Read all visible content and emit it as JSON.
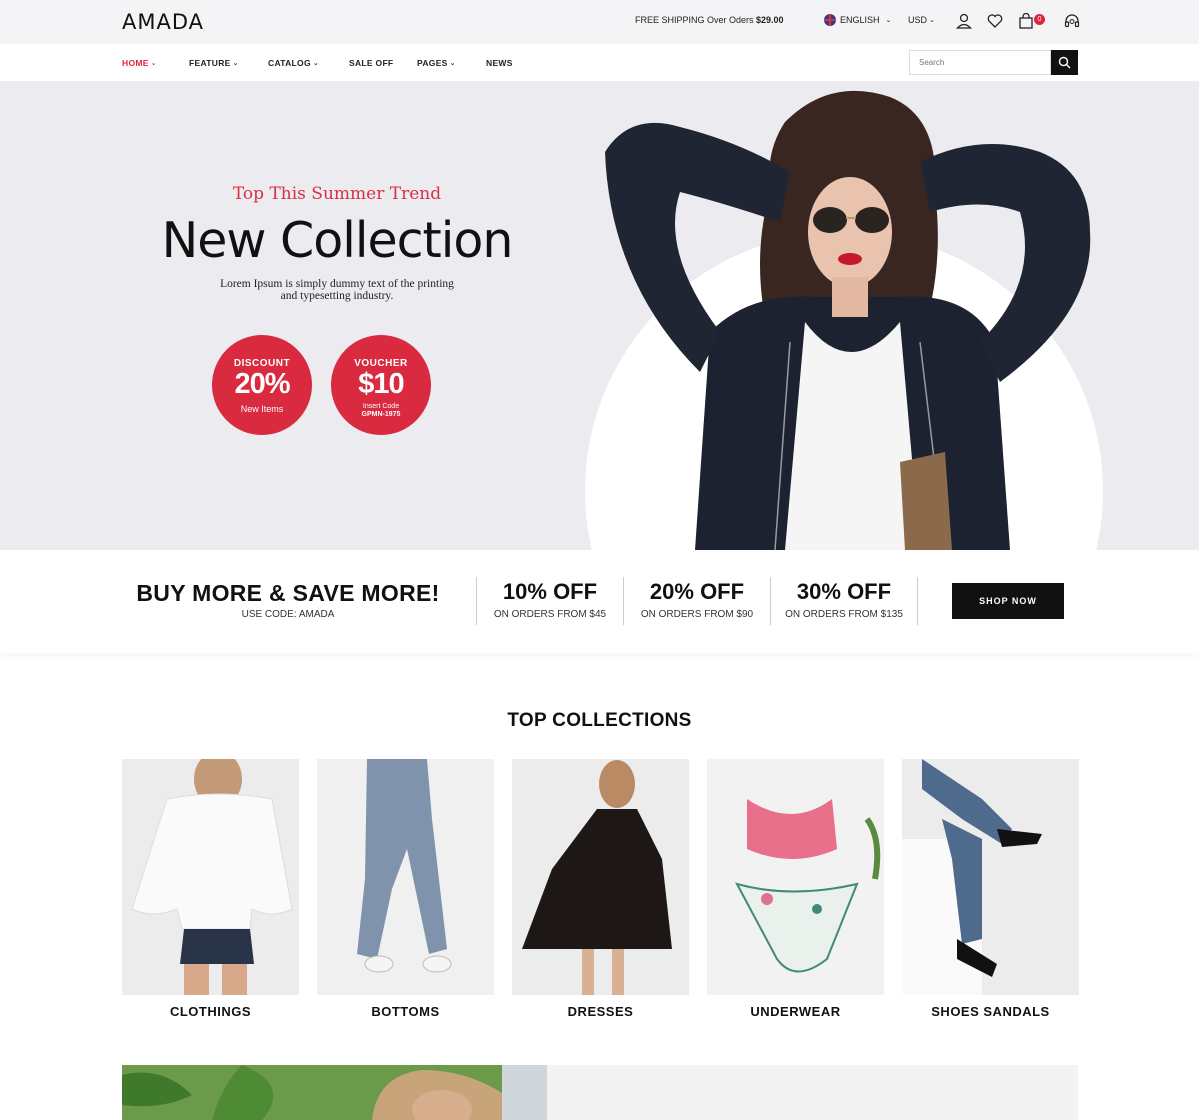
{
  "header": {
    "logo": "AMADA",
    "shipping_text": "FREE SHIPPING Over Oders ",
    "shipping_amount": "$29.00",
    "language": "ENGLISH",
    "currency": "USD",
    "cart_count": "0"
  },
  "nav": {
    "items": [
      "HOME",
      "FEATURE",
      "CATALOG",
      "SALE OFF",
      "PAGES",
      "NEWS"
    ],
    "search_placeholder": "Search"
  },
  "hero": {
    "tagline": "Top This Summer Trend",
    "headline": "New Collection",
    "subtext": "Lorem Ipsum is simply dummy text of the printing and typesetting industry.",
    "discount": {
      "label": "DISCOUNT",
      "value": "20%",
      "note": "New Items"
    },
    "voucher": {
      "label": "VOUCHER",
      "value": "$10",
      "note": "Insert Code",
      "code": "GPMN-1975"
    }
  },
  "promo": {
    "title": "BUY MORE & SAVE MORE!",
    "code": "USE CODE: AMADA",
    "offers": [
      {
        "title": "10% OFF",
        "sub": "ON ORDERS FROM $45"
      },
      {
        "title": "20% OFF",
        "sub": "ON ORDERS FROM $90"
      },
      {
        "title": "30% OFF",
        "sub": "ON ORDERS FROM $135"
      }
    ],
    "button": "SHOP NOW"
  },
  "collections": {
    "title": "TOP COLLECTIONS",
    "items": [
      "CLOTHINGS",
      "BOTTOMS",
      "DRESSES",
      "UNDERWEAR",
      "SHOES SANDALS"
    ]
  },
  "colors": {
    "accent": "#e0243c",
    "dark": "#111111",
    "hero_bg": "#ecebef"
  },
  "icons": [
    "user-icon",
    "heart-icon",
    "bag-icon",
    "headset-icon",
    "search-icon",
    "chevron-down-icon"
  ]
}
